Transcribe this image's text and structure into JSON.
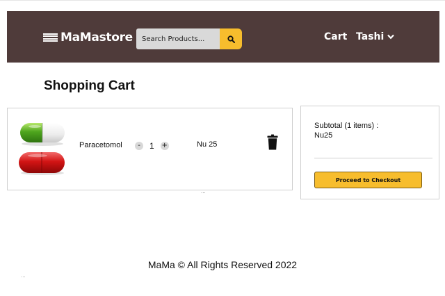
{
  "header": {
    "brand": "MaMastore",
    "search_placeholder": "Search Products...",
    "nav_cart": "Cart",
    "nav_user": "Tashi",
    "background_color": "#4f3b3a",
    "accent_color": "#f7bd2d"
  },
  "page": {
    "title": "Shopping Cart"
  },
  "cart": {
    "items": [
      {
        "name": "Paracetomol",
        "quantity": "1",
        "decrement_label": "-",
        "increment_label": "+",
        "price": "Nu 25",
        "image_icon": "capsule-pills-image",
        "delete_icon": "trash-icon"
      }
    ],
    "more_indicator": "..."
  },
  "summary": {
    "subtotal_label": "Subtotal (1 items) :",
    "subtotal_value": "Nu25",
    "checkout_label": "Proceed to Checkout"
  },
  "footer": {
    "text": "MaMa © All Rights Reserved 2022",
    "more_indicator": "..."
  }
}
